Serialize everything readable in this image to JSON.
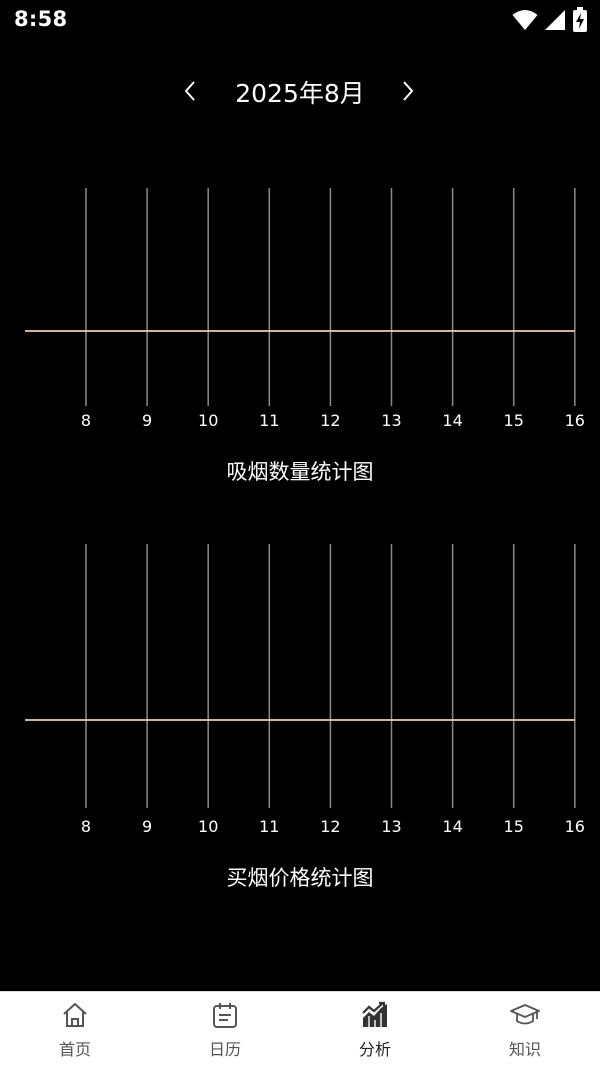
{
  "status_bar": {
    "time": "8:58"
  },
  "month_nav": {
    "prev_icon": "chevron-left-icon",
    "title": "2025年8月",
    "next_icon": "chevron-right-icon"
  },
  "colors": {
    "background": "#000000",
    "gridline": "#8a8a8a",
    "series_line": "#f0cdb4",
    "axis_label": "#ffffff",
    "tabbar_bg": "#ffffff",
    "tab_label": "#555555"
  },
  "chart_data": [
    {
      "type": "line",
      "title": "吸烟数量统计图",
      "categories": [
        "8",
        "9",
        "10",
        "11",
        "12",
        "13",
        "14",
        "15",
        "16"
      ],
      "series": [
        {
          "values": [
            0,
            0,
            0,
            0,
            0,
            0,
            0,
            0,
            0
          ]
        }
      ],
      "grid": true
    },
    {
      "type": "line",
      "title": "买烟价格统计图",
      "categories": [
        "8",
        "9",
        "10",
        "11",
        "12",
        "13",
        "14",
        "15",
        "16"
      ],
      "series": [
        {
          "values": [
            0,
            0,
            0,
            0,
            0,
            0,
            0,
            0,
            0
          ]
        }
      ],
      "grid": true
    }
  ],
  "tab_bar": {
    "items": [
      {
        "label": "首页",
        "icon": "home-icon"
      },
      {
        "label": "日历",
        "icon": "calendar-icon"
      },
      {
        "label": "分析",
        "icon": "chart-icon",
        "active": true
      },
      {
        "label": "知识",
        "icon": "graduation-cap-icon"
      }
    ]
  }
}
